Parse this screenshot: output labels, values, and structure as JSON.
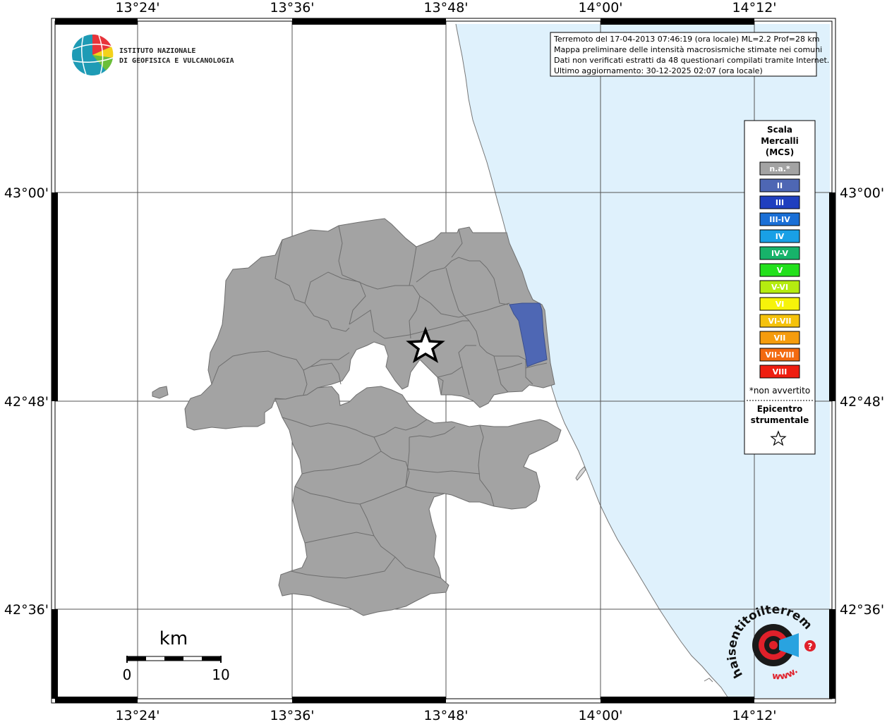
{
  "map": {
    "longitude_ticks": [
      "13°24'",
      "13°36'",
      "13°48'",
      "14°00'",
      "14°12'"
    ],
    "latitude_ticks": [
      "43°00'",
      "42°48'",
      "42°36'"
    ],
    "colors": {
      "sea": "#dff1fc",
      "municipality_na": "#a3a3a3",
      "municipality_border": "#6e6e6e",
      "intensity_II": "#4e67b4"
    }
  },
  "institute": {
    "line1": "ISTITUTO NAZIONALE",
    "line2": "DI GEOFISICA E VULCANOLOGIA"
  },
  "info": {
    "line1": "Terremoto del 17-04-2013 07:46:19 (ora locale) ML=2.2 Prof=28 km",
    "line2": "Mappa preliminare delle intensità macrosismiche stimate nei comuni",
    "line3": "Dati non verificati estratti da 48 questionari compilati tramite Internet.",
    "line4": "Ultimo aggiornamento: 30-12-2025 02:07 (ora locale)"
  },
  "legend": {
    "title1": "Scala",
    "title2": "Mercalli",
    "title3": "(MCS)",
    "items": [
      {
        "label": "n.a.*",
        "color": "#a3a3a3"
      },
      {
        "label": "II",
        "color": "#4e67b4"
      },
      {
        "label": "III",
        "color": "#1f3fbf"
      },
      {
        "label": "III-IV",
        "color": "#1a6fd6"
      },
      {
        "label": "IV",
        "color": "#19a0e6"
      },
      {
        "label": "IV-V",
        "color": "#17b36a"
      },
      {
        "label": "V",
        "color": "#22e01c"
      },
      {
        "label": "V-VI",
        "color": "#b5ec10"
      },
      {
        "label": "VI",
        "color": "#f6f30a"
      },
      {
        "label": "VI-VII",
        "color": "#f5c20c"
      },
      {
        "label": "VII",
        "color": "#f59c0d"
      },
      {
        "label": "VII-VIII",
        "color": "#f36a10"
      },
      {
        "label": "VIII",
        "color": "#ee1d10"
      }
    ],
    "note": "*non avvertito",
    "epicenter1": "Epicentro",
    "epicenter2": "strumentale"
  },
  "scale_bar": {
    "unit": "km",
    "start": "0",
    "end": "10"
  },
  "brand": {
    "text": "haisentitoilterremoto.it",
    "url_text": "www."
  }
}
